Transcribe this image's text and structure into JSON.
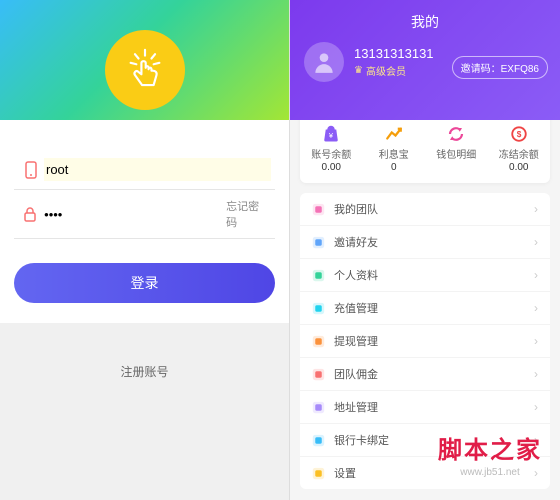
{
  "login": {
    "username_value": "root",
    "password_value": "••••",
    "forgot_label": "忘记密码",
    "login_button": "登录",
    "register_label": "注册账号"
  },
  "profile": {
    "title": "我的",
    "user_id": "13131313131",
    "member_level": "高级会员",
    "invite_label": "邀请码：",
    "invite_code": "EXFQ86"
  },
  "stats": [
    {
      "icon": "bag",
      "color": "#8b5cf6",
      "label": "账号余额",
      "value": "0.00"
    },
    {
      "icon": "chart",
      "color": "#f59e0b",
      "label": "利息宝",
      "value": "0"
    },
    {
      "icon": "swap",
      "color": "#ec4899",
      "label": "钱包明细",
      "value": ""
    },
    {
      "icon": "coin",
      "color": "#ef4444",
      "label": "冻结余额",
      "value": "0.00"
    }
  ],
  "menu": [
    {
      "color": "#f472b6",
      "label": "我的团队"
    },
    {
      "color": "#60a5fa",
      "label": "邀请好友"
    },
    {
      "color": "#34d399",
      "label": "个人资料"
    },
    {
      "color": "#22d3ee",
      "label": "充值管理"
    },
    {
      "color": "#fb923c",
      "label": "提现管理"
    },
    {
      "color": "#f87171",
      "label": "团队佣金"
    },
    {
      "color": "#a78bfa",
      "label": "地址管理"
    },
    {
      "color": "#38bdf8",
      "label": "银行卡绑定"
    },
    {
      "color": "#fbbf24",
      "label": "设置"
    }
  ],
  "watermark": {
    "brand": "脚本之家",
    "url": "www.jb51.net"
  }
}
